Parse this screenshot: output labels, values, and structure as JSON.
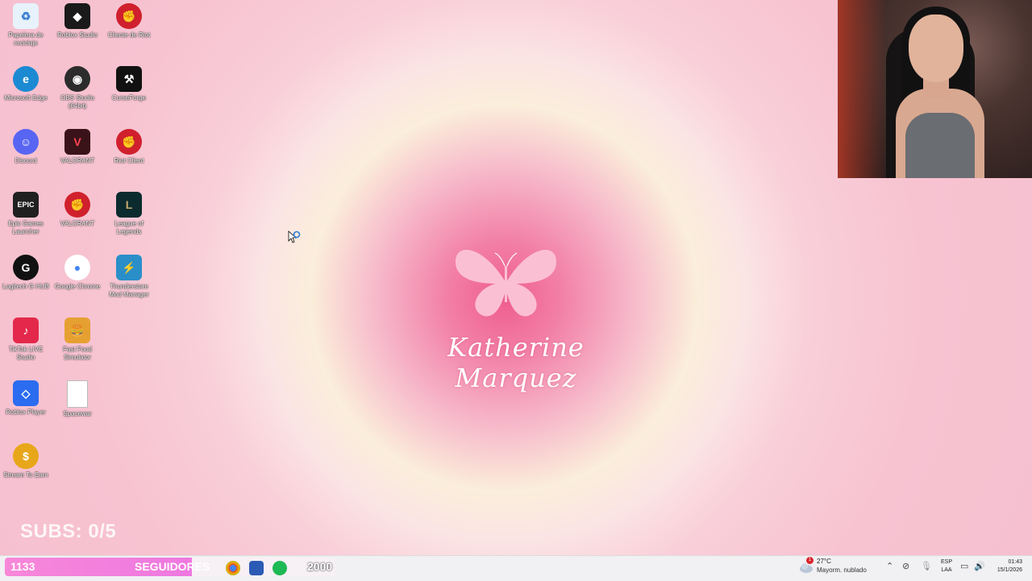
{
  "desktop": {
    "icons": [
      {
        "label": "Papelera de reciclaje",
        "icon": "recycle-bin-icon",
        "color": "#e8f2fb",
        "glyph": "♻",
        "glyph_color": "#3b7fd0"
      },
      {
        "label": "Roblox Studio",
        "icon": "roblox-studio-icon",
        "color": "#1a1a1a",
        "glyph": "◆"
      },
      {
        "label": "Cliente de Riot",
        "icon": "riot-client-icon",
        "color": "#d0202d",
        "glyph": "✊"
      },
      {
        "label": "Microsoft Edge",
        "icon": "edge-icon",
        "color": "#1b8ad2",
        "glyph": "e"
      },
      {
        "label": "OBS Studio (64bit)",
        "icon": "obs-icon",
        "color": "#2c2c2c",
        "glyph": "◉"
      },
      {
        "label": "CurseForge",
        "icon": "curseforge-icon",
        "color": "#111111",
        "glyph": "⚒"
      },
      {
        "label": "Discord",
        "icon": "discord-icon",
        "color": "#5865f2",
        "glyph": "☺"
      },
      {
        "label": "VALORANT",
        "icon": "valorant-icon",
        "color": "#3a1318",
        "glyph": "V",
        "glyph_color": "#ff4655"
      },
      {
        "label": "Riot Client",
        "icon": "riot-client-icon",
        "color": "#d0202d",
        "glyph": "✊"
      },
      {
        "label": "Epic Games Launcher",
        "icon": "epic-games-icon",
        "color": "#202020",
        "glyph": "EPIC"
      },
      {
        "label": "VALORANT",
        "icon": "valorant-riot-icon",
        "color": "#d0202d",
        "glyph": "✊"
      },
      {
        "label": "League of Legends",
        "icon": "league-of-legends-icon",
        "color": "#0b2b2e",
        "glyph": "L",
        "glyph_color": "#c8aa6e"
      },
      {
        "label": "Logitech G HUB",
        "icon": "logitech-ghub-icon",
        "color": "#111111",
        "glyph": "G"
      },
      {
        "label": "Google Chrome",
        "icon": "chrome-icon",
        "color": "#ffffff",
        "glyph": "●",
        "glyph_color": "#4285f4"
      },
      {
        "label": "Thunderstore Mod Manager",
        "icon": "thunderstore-icon",
        "color": "#2a8fc9",
        "glyph": "⚡"
      },
      {
        "label": "TikTok LIVE Studio",
        "icon": "tiktok-live-icon",
        "color": "#e3284b",
        "glyph": "♪"
      },
      {
        "label": "Fast Food Simulator",
        "icon": "fast-food-simulator-icon",
        "color": "#e6a032",
        "glyph": "🍔"
      },
      {
        "label": "Roblox Player",
        "icon": "roblox-player-icon",
        "color": "#2b6cf0",
        "glyph": "◇"
      },
      {
        "label": "Spacewar",
        "icon": "file-icon",
        "color": "#ffffff",
        "glyph": "",
        "glyph_color": "#999999"
      },
      {
        "label": "Stream To Earn",
        "icon": "stream-to-earn-icon",
        "color": "#e8a71a",
        "glyph": "$"
      }
    ]
  },
  "wallpaper": {
    "name": "Katherine Marquez",
    "logo": "butterfly-icon"
  },
  "overlay": {
    "subs_text": "SUBS: 0/5",
    "followers": {
      "count": "1133",
      "label": "SEGUIDORES",
      "goal": "2000",
      "progress": 0.5665
    }
  },
  "taskbar": {
    "pinned": [
      "chrome-icon",
      "store-icon",
      "spotify-icon"
    ],
    "weather": {
      "temp": "27°C",
      "desc": "Mayorm. nublado",
      "alert_count": "1"
    },
    "language": {
      "line1": "ESP",
      "line2": "LAA"
    },
    "clock": {
      "time": "01:43",
      "date": "15/1/2026"
    }
  },
  "colors": {
    "accent_pink": "#ef5d8f",
    "follower_bar": "#f788d9"
  }
}
